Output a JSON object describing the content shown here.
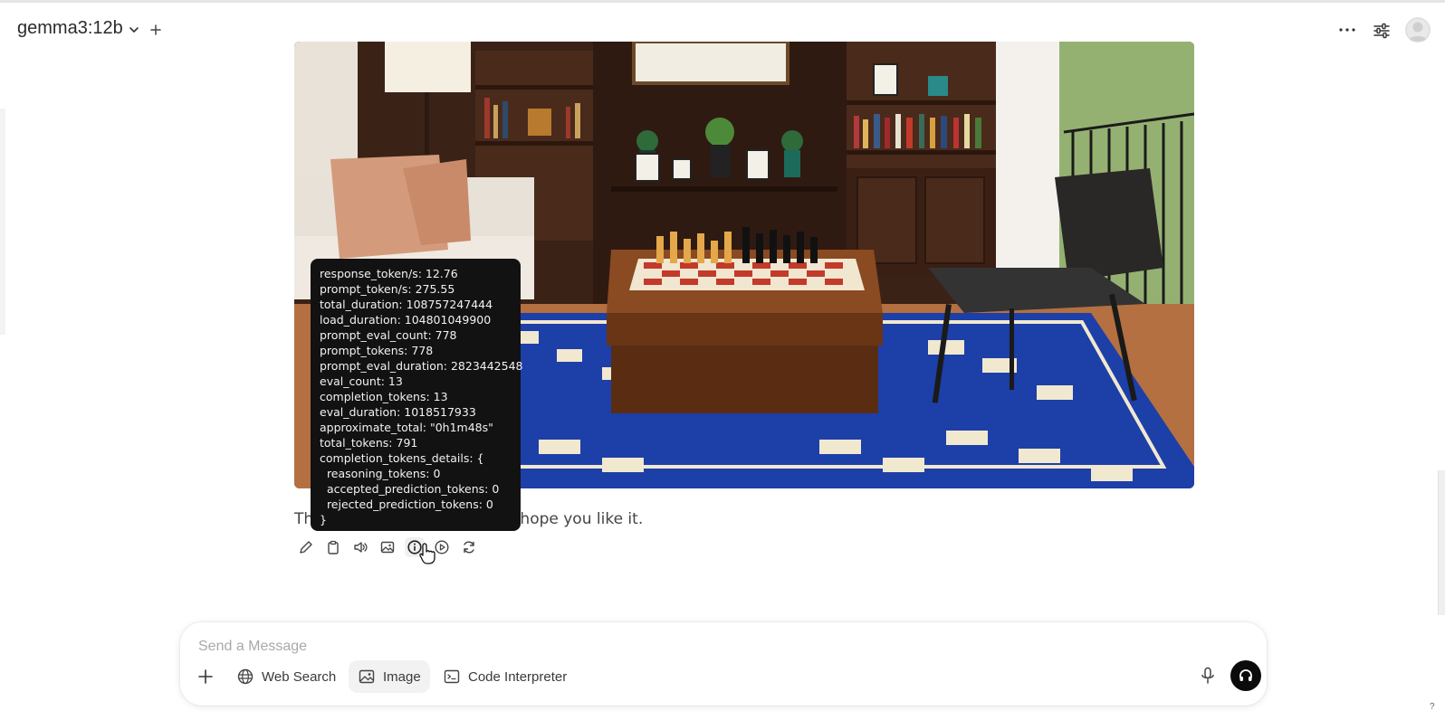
{
  "header": {
    "model_name": "gemma3:12b"
  },
  "message": {
    "text_lead": "Th",
    "text_tail": "I hope you like it."
  },
  "tooltip": {
    "lines": [
      "response_token/s: 12.76",
      "prompt_token/s: 275.55",
      "total_duration: 108757247444",
      "load_duration: 104801049900",
      "prompt_eval_count: 778",
      "prompt_tokens: 778",
      "prompt_eval_duration: 2823442548",
      "eval_count: 13",
      "completion_tokens: 13",
      "eval_duration: 1018517933",
      "approximate_total: \"0h1m48s\"",
      "total_tokens: 791",
      "completion_tokens_details: {",
      "  reasoning_tokens: 0",
      "  accepted_prediction_tokens: 0",
      "  rejected_prediction_tokens: 0",
      "}"
    ]
  },
  "composer": {
    "placeholder": "Send a Message",
    "web_search_label": "Web Search",
    "image_label": "Image",
    "code_interpreter_label": "Code Interpreter"
  },
  "footer": {
    "help_label": "?"
  },
  "icons": {
    "edit": "pencil-icon",
    "copy": "clipboard-icon",
    "read_aloud": "speaker-icon",
    "image": "image-icon",
    "info": "info-icon",
    "continue": "play-icon",
    "regenerate": "refresh-icon"
  },
  "colors": {
    "tooltip_bg": "#121212",
    "voice_button_bg": "#0b0b0b",
    "selected_tool_bg": "#f2f2f2"
  }
}
